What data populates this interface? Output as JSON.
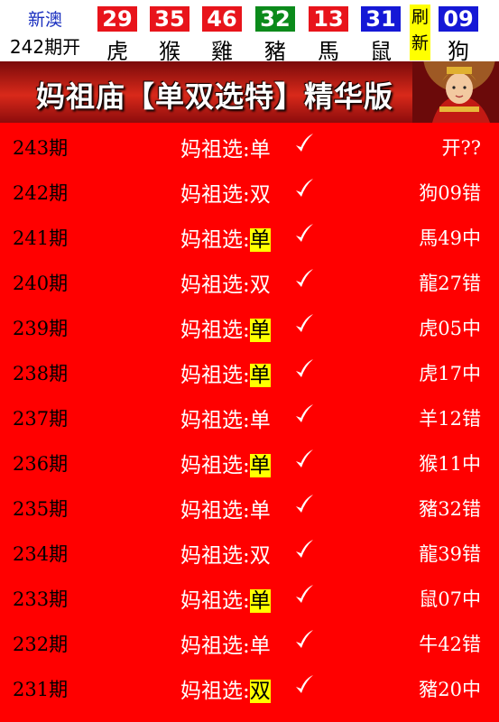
{
  "header": {
    "site_name": "新澳",
    "period_open": "242期开",
    "refresh_label": "刷新",
    "balls": [
      {
        "number": "29",
        "zodiac": "虎",
        "color": "#e8141b"
      },
      {
        "number": "35",
        "zodiac": "猴",
        "color": "#e8141b"
      },
      {
        "number": "46",
        "zodiac": "雞",
        "color": "#e8141b"
      },
      {
        "number": "32",
        "zodiac": "豬",
        "color": "#0b8a1b"
      },
      {
        "number": "13",
        "zodiac": "馬",
        "color": "#e8141b"
      },
      {
        "number": "31",
        "zodiac": "鼠",
        "color": "#1518d6"
      },
      {
        "number": "09",
        "zodiac": "狗",
        "color": "#1518d6"
      }
    ]
  },
  "banner": {
    "title": "妈祖庙【单双选特】精华版"
  },
  "rows": [
    {
      "period": "243期",
      "label": "妈祖选:",
      "value": "单",
      "highlight": false,
      "result": "开??"
    },
    {
      "period": "242期",
      "label": "妈祖选:",
      "value": "双",
      "highlight": false,
      "result": "狗09错"
    },
    {
      "period": "241期",
      "label": "妈祖选:",
      "value": "单",
      "highlight": true,
      "result": "馬49中"
    },
    {
      "period": "240期",
      "label": "妈祖选:",
      "value": "双",
      "highlight": false,
      "result": "龍27错"
    },
    {
      "period": "239期",
      "label": "妈祖选:",
      "value": "单",
      "highlight": true,
      "result": "虎05中"
    },
    {
      "period": "238期",
      "label": "妈祖选:",
      "value": "单",
      "highlight": true,
      "result": "虎17中"
    },
    {
      "period": "237期",
      "label": "妈祖选:",
      "value": "单",
      "highlight": false,
      "result": "羊12错"
    },
    {
      "period": "236期",
      "label": "妈祖选:",
      "value": "单",
      "highlight": true,
      "result": "猴11中"
    },
    {
      "period": "235期",
      "label": "妈祖选:",
      "value": "单",
      "highlight": false,
      "result": "豬32错"
    },
    {
      "period": "234期",
      "label": "妈祖选:",
      "value": "双",
      "highlight": false,
      "result": "龍39错"
    },
    {
      "period": "233期",
      "label": "妈祖选:",
      "value": "单",
      "highlight": true,
      "result": "鼠07中"
    },
    {
      "period": "232期",
      "label": "妈祖选:",
      "value": "单",
      "highlight": false,
      "result": "牛42错"
    },
    {
      "period": "231期",
      "label": "妈祖选:",
      "value": "双",
      "highlight": true,
      "result": "豬20中"
    }
  ]
}
